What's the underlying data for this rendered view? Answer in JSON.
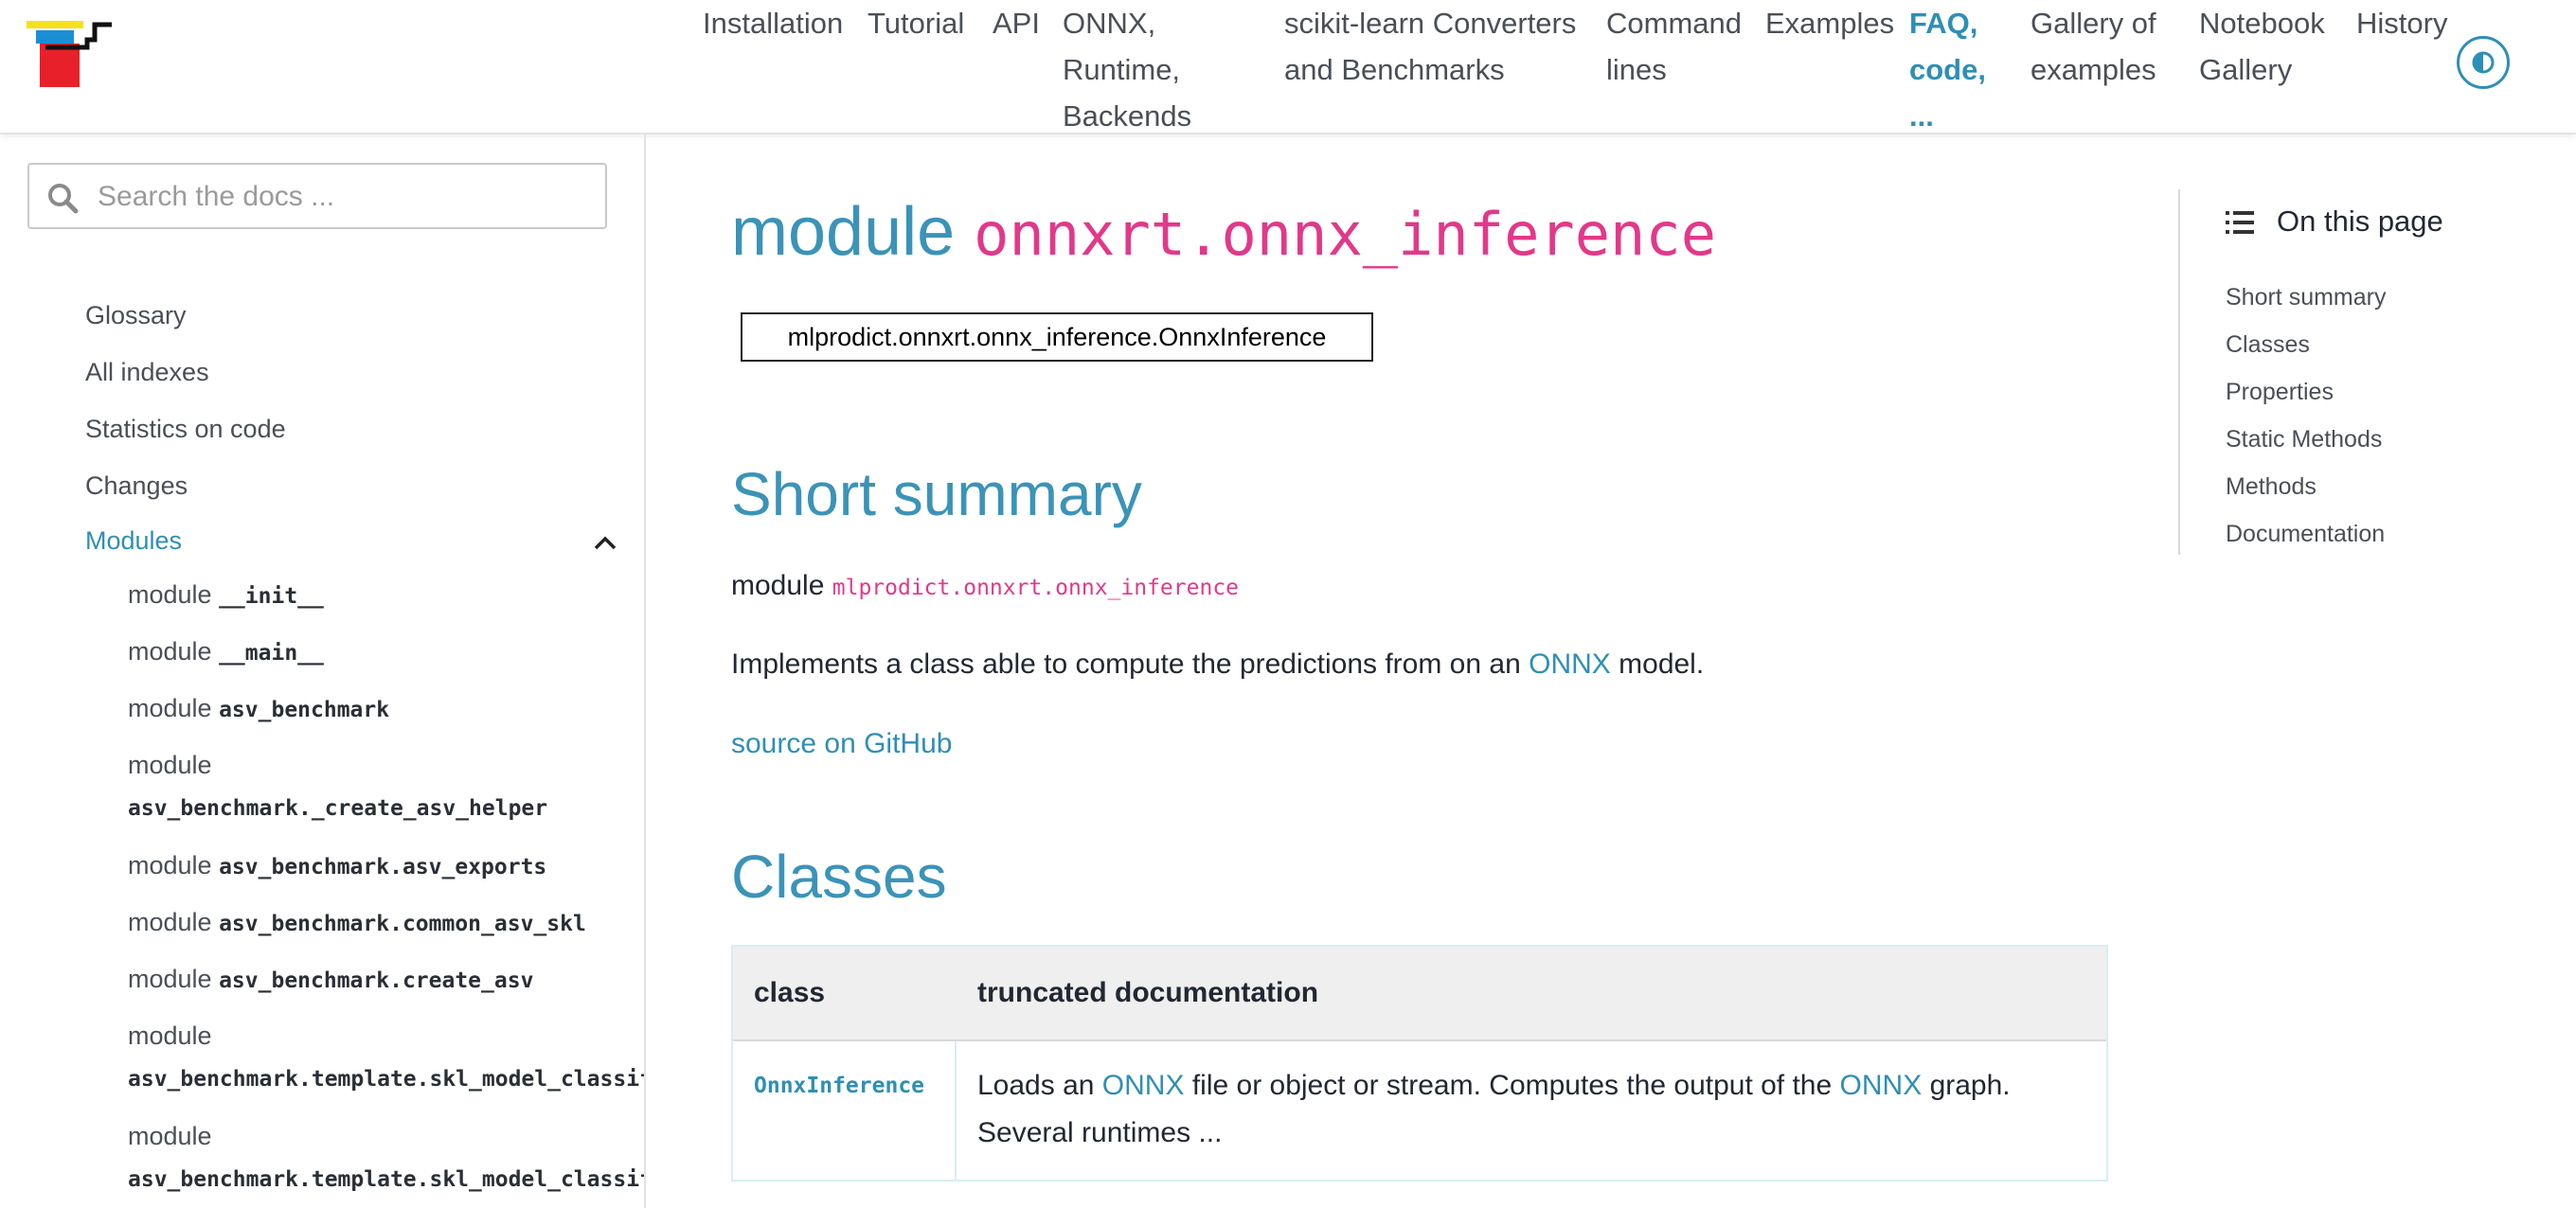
{
  "header": {
    "nav": [
      {
        "label": "Installation"
      },
      {
        "label": "Tutorial"
      },
      {
        "label": "API"
      },
      {
        "label": "ONNX, Runtime, Backends"
      },
      {
        "label": "scikit-learn Converters and Benchmarks"
      },
      {
        "label": "Command lines"
      },
      {
        "label": "Examples"
      },
      {
        "label": "FAQ, code, ..."
      },
      {
        "label": "Gallery of examples"
      },
      {
        "label": "Notebook Gallery"
      },
      {
        "label": "History"
      }
    ],
    "theme_toggle_icon": "contrast-icon",
    "accent_color": "#2e8fb4"
  },
  "sidebar": {
    "search_placeholder": "Search the docs ...",
    "items": [
      {
        "label": "Glossary"
      },
      {
        "label": "All indexes"
      },
      {
        "label": "Statistics on code"
      },
      {
        "label": "Changes"
      },
      {
        "label": "Modules"
      }
    ],
    "modules": [
      {
        "prefix": "module",
        "code": "__init__"
      },
      {
        "prefix": "module",
        "code": "__main__"
      },
      {
        "prefix": "module",
        "code": "asv_benchmark"
      },
      {
        "prefix": "module",
        "code": "asv_benchmark._create_asv_helper"
      },
      {
        "prefix": "module",
        "code": "asv_benchmark.asv_exports"
      },
      {
        "prefix": "module",
        "code": "asv_benchmark.common_asv_skl"
      },
      {
        "prefix": "module",
        "code": "asv_benchmark.create_asv"
      },
      {
        "prefix": "module",
        "code": "asv_benchmark.template.skl_model_classifi"
      },
      {
        "prefix": "module",
        "code": "asv_benchmark.template.skl_model_classifi"
      }
    ]
  },
  "main": {
    "title_word": "module",
    "title_code": "onnxrt.onnx_inference",
    "class_box": "mlprodict.onnxrt.onnx_inference.OnnxInference",
    "short_summary_heading": "Short summary",
    "summary_prefix": "module",
    "summary_code": "mlprodict.onnxrt.onnx_inference",
    "implements_before": "Implements a class able to compute the predictions from on an",
    "implements_link": "ONNX",
    "implements_after": "model.",
    "source_link": "source on GitHub",
    "classes_heading": "Classes",
    "table": {
      "headers": [
        "class",
        "truncated documentation"
      ],
      "rows": [
        {
          "class": "OnnxInference",
          "desc_1": "Loads an",
          "desc_link_1": "ONNX",
          "desc_2": "file or object or stream. Computes the output of the",
          "desc_link_2": "ONNX",
          "desc_3": "graph. Several runtimes ..."
        }
      ]
    }
  },
  "toc": {
    "title": "On this page",
    "items": [
      {
        "label": "Short summary"
      },
      {
        "label": "Classes"
      },
      {
        "label": "Properties"
      },
      {
        "label": "Static Methods"
      },
      {
        "label": "Methods"
      },
      {
        "label": "Documentation"
      }
    ]
  }
}
